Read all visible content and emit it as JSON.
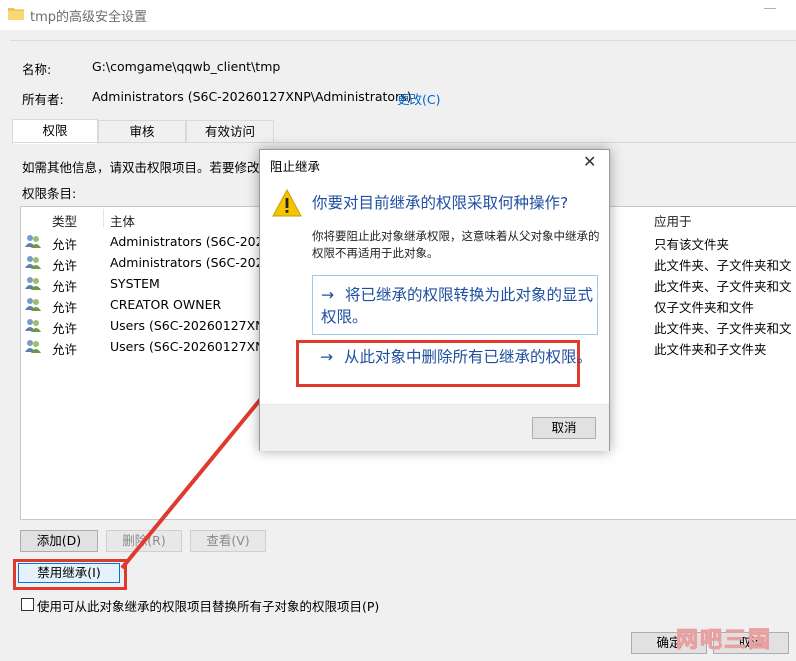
{
  "window": {
    "title": "tmp的高级安全设置"
  },
  "info": {
    "name_label": "名称:",
    "name_value": "G:\\comgame\\qqwb_client\\tmp",
    "owner_label": "所有者:",
    "owner_value": "Administrators (S6C-20260127XNP\\Administrators)",
    "change_link": "更改(C)"
  },
  "tabs": [
    "权限",
    "审核",
    "有效访问"
  ],
  "hint": "如需其他信息，请双击权限项目。若要修改",
  "entries_label": "权限条目:",
  "columns": {
    "type": "类型",
    "principal": "主体",
    "applies": "应用于"
  },
  "rows": [
    {
      "type": "允许",
      "principal": "Administrators (S6C-20260",
      "applies": "只有该文件夹"
    },
    {
      "type": "允许",
      "principal": "Administrators (S6C-20260",
      "applies": "此文件夹、子文件夹和文"
    },
    {
      "type": "允许",
      "principal": "SYSTEM",
      "applies": "此文件夹、子文件夹和文"
    },
    {
      "type": "允许",
      "principal": "CREATOR OWNER",
      "applies": "仅子文件夹和文件"
    },
    {
      "type": "允许",
      "principal": "Users (S6C-20260127XNP",
      "applies": "此文件夹、子文件夹和文"
    },
    {
      "type": "允许",
      "principal": "Users (S6C-20260127XNP",
      "applies": "此文件夹和子文件夹"
    }
  ],
  "buttons": {
    "add": "添加(D)",
    "remove": "删除(R)",
    "view": "查看(V)",
    "disable_inherit": "禁用继承(I)",
    "ok": "确定",
    "cancel": "取消"
  },
  "replace_checkbox": "使用可从此对象继承的权限项目替换所有子对象的权限项目(P)",
  "dialog": {
    "title": "阻止继承",
    "close": "✕",
    "question": "你要对目前继承的权限采取何种操作?",
    "info": "你将要阻止此对象继承权限，这意味着从父对象中继承的权限不再适用于此对象。",
    "option1_arrow": "→",
    "option1": "将已继承的权限转换为此对象的显式权限。",
    "option2_arrow": "→",
    "option2": "从此对象中删除所有已继承的权限。",
    "cancel": "取消"
  },
  "watermark": "网吧三国",
  "colors": {
    "accent": "#0078d7",
    "highlight": "#e03a2f",
    "link": "#1f4fa0"
  }
}
